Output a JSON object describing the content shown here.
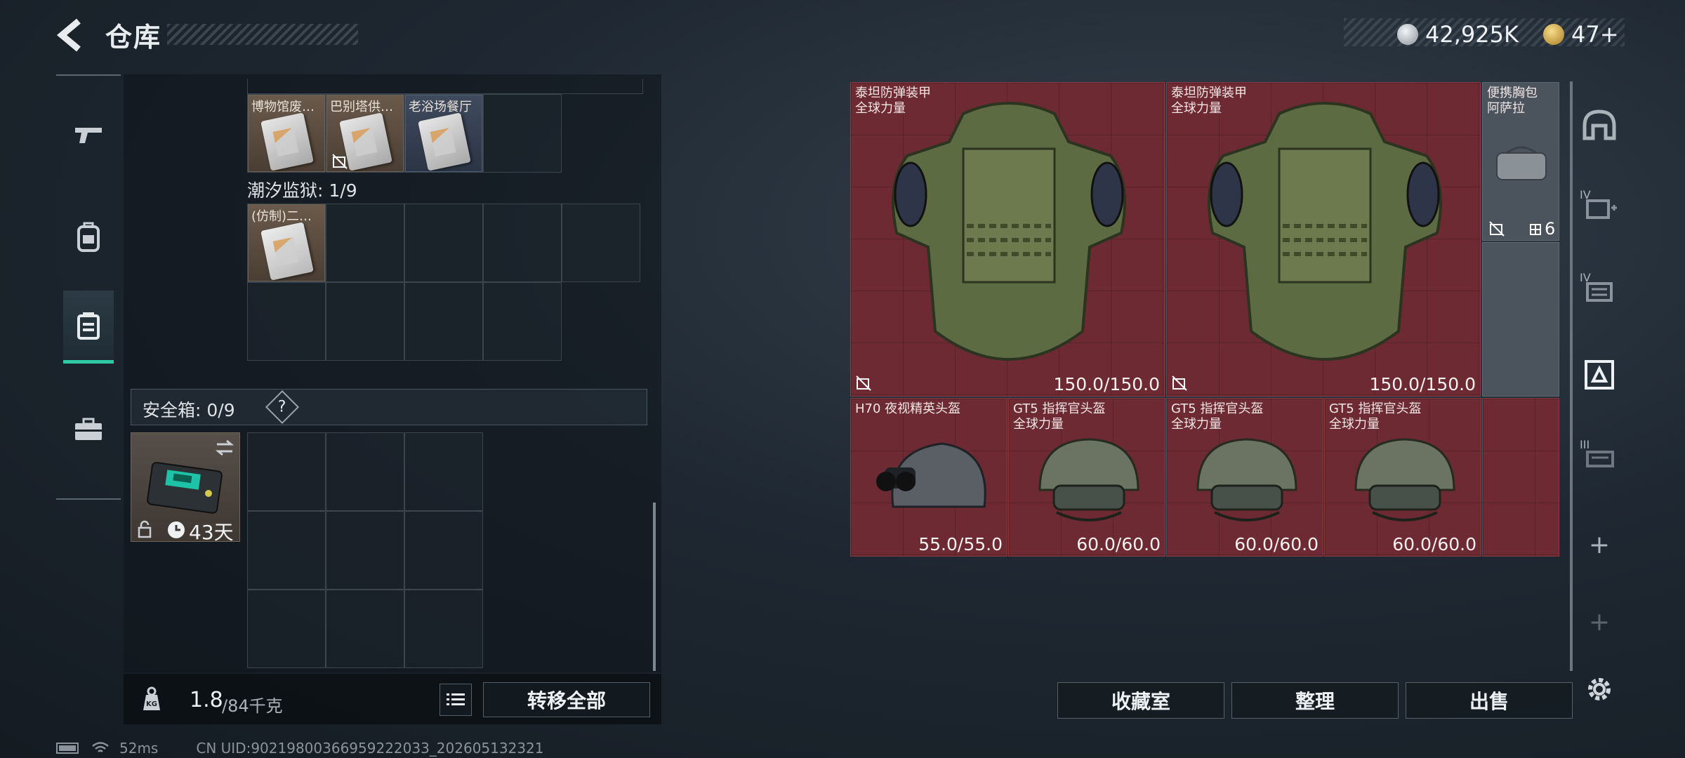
{
  "header": {
    "title": "仓库",
    "currencies": [
      {
        "value": "42,925K",
        "icon": "silver-coin-icon",
        "color": "#b8bec4"
      },
      {
        "value": "47+",
        "icon": "gold-coin-icon",
        "color": "#d4a943"
      }
    ]
  },
  "left_nav": {
    "items": [
      {
        "name": "weapons",
        "icon": "gun-icon"
      },
      {
        "name": "armor",
        "icon": "backpack-icon"
      },
      {
        "name": "containers",
        "icon": "container-icon",
        "active": true
      },
      {
        "name": "supplies",
        "icon": "briefcase-icon"
      }
    ]
  },
  "stash": {
    "top_items": [
      {
        "label": "博物馆废…"
      },
      {
        "label": "巴别塔供…"
      },
      {
        "label": "老浴场餐厅"
      }
    ],
    "tidal_prison": {
      "label": "潮汐监狱: 1/9",
      "items": [
        {
          "label": "(仿制)二…"
        }
      ]
    },
    "safe_box": {
      "label": "安全箱: 0/9",
      "help": "?",
      "days": "43天"
    }
  },
  "weight": {
    "current": "1.8",
    "max": "/84千克",
    "transfer_all": "转移全部"
  },
  "equipment": {
    "items": [
      {
        "name": "泰坦防弹装甲\n全球力量",
        "durability": "150.0/150.0"
      },
      {
        "name": "泰坦防弹装甲\n全球力量",
        "durability": "150.0/150.0"
      },
      {
        "name": "便携胸包\n阿萨拉",
        "count": "6"
      },
      {
        "name": "H70 夜视精英头盔",
        "durability": "55.0/55.0"
      },
      {
        "name": "GT5 指挥官头盔\n全球力量",
        "durability": "60.0/60.0"
      },
      {
        "name": "GT5 指挥官头盔\n全球力量",
        "durability": "60.0/60.0"
      },
      {
        "name": "GT5 指挥官头盔\n全球力量",
        "durability": "60.0/60.0"
      }
    ]
  },
  "actions": {
    "collection": "收藏室",
    "organize": "整理",
    "sell": "出售"
  },
  "right_nav": {
    "levels": [
      "IV",
      "IV",
      "III"
    ],
    "plus": "+"
  },
  "status": {
    "ping": "52ms",
    "uid": "CN UID:902198003669592220​33_202605132321"
  },
  "colors": {
    "accent": "#2fc8a4",
    "equip_bg": "#6e2a32",
    "item_brown": "#5a4a3e"
  }
}
